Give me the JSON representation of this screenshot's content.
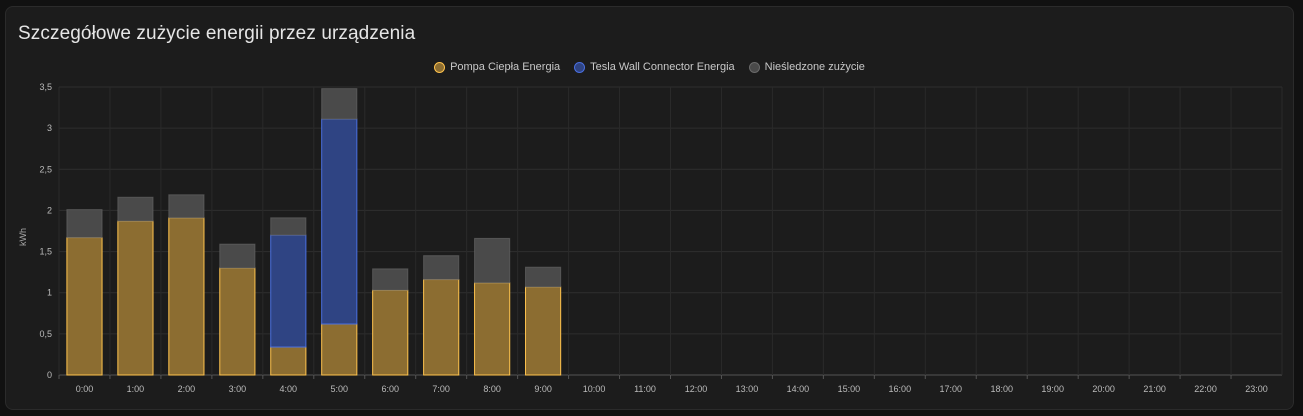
{
  "card": {
    "title": "Szczegółowe zużycie energii przez urządzenia"
  },
  "legend": [
    {
      "label": "Pompa Ciepła Energia",
      "fill": "#8c6d31",
      "stroke": "#ffc34d"
    },
    {
      "label": "Tesla Wall Connector Energia",
      "fill": "#2f4483",
      "stroke": "#4a6fe0"
    },
    {
      "label": "Nieśledzone zużycie",
      "fill": "#4a4a4a",
      "stroke": "#6a6a6a"
    }
  ],
  "chart_data": {
    "type": "bar",
    "stacked": true,
    "ylabel": "kWh",
    "ylim": [
      0,
      3.5
    ],
    "yticks": [
      "0",
      "0,5",
      "1",
      "1,5",
      "2",
      "2,5",
      "3",
      "3,5"
    ],
    "categories": [
      "0:00",
      "1:00",
      "2:00",
      "3:00",
      "4:00",
      "5:00",
      "6:00",
      "7:00",
      "8:00",
      "9:00",
      "10:00",
      "11:00",
      "12:00",
      "13:00",
      "14:00",
      "15:00",
      "16:00",
      "17:00",
      "18:00",
      "19:00",
      "20:00",
      "21:00",
      "22:00",
      "23:00"
    ],
    "series": [
      {
        "name": "Pompa Ciepła Energia",
        "values": [
          1.67,
          1.87,
          1.91,
          1.3,
          0.34,
          0.62,
          1.03,
          1.16,
          1.12,
          1.07,
          0,
          0,
          0,
          0,
          0,
          0,
          0,
          0,
          0,
          0,
          0,
          0,
          0,
          0
        ]
      },
      {
        "name": "Tesla Wall Connector Energia",
        "values": [
          0,
          0,
          0,
          0,
          1.36,
          2.49,
          0,
          0,
          0,
          0,
          0,
          0,
          0,
          0,
          0,
          0,
          0,
          0,
          0,
          0,
          0,
          0,
          0,
          0
        ]
      },
      {
        "name": "Nieśledzone zużycie",
        "values": [
          0.34,
          0.29,
          0.28,
          0.29,
          0.21,
          0.37,
          0.26,
          0.29,
          0.54,
          0.24,
          0,
          0,
          0,
          0,
          0,
          0,
          0,
          0,
          0,
          0,
          0,
          0,
          0,
          0
        ]
      }
    ],
    "grid": true,
    "legend_position": "top-center"
  }
}
